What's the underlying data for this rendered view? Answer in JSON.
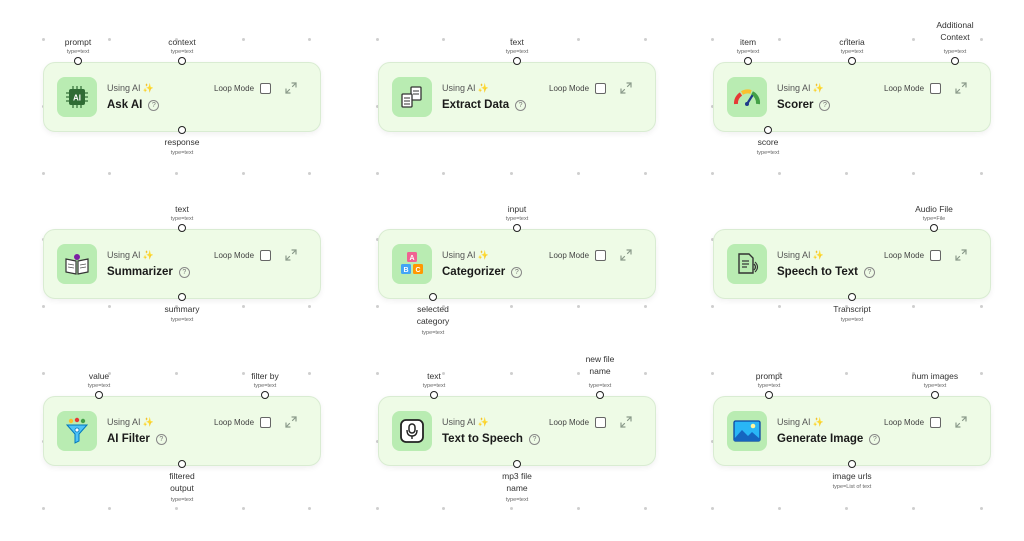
{
  "common": {
    "using_ai": "Using AI",
    "loop_mode": "Loop Mode",
    "help": "?"
  },
  "nodes": [
    {
      "title": "Ask AI",
      "icon": "ai-chip-icon",
      "inputs": [
        {
          "label": "prompt",
          "type": "type=text"
        },
        {
          "label": "context",
          "type": "type=text"
        }
      ],
      "outputs": [
        {
          "label": "response",
          "type": "type=text"
        }
      ]
    },
    {
      "title": "Extract Data",
      "icon": "documents-icon",
      "inputs": [
        {
          "label": "text",
          "type": "type=text"
        }
      ],
      "outputs": []
    },
    {
      "title": "Scorer",
      "icon": "gauge-icon",
      "inputs": [
        {
          "label": "item",
          "type": "type=text"
        },
        {
          "label": "criteria",
          "type": "type=text"
        },
        {
          "label": "Additional Context",
          "type": "type=text"
        }
      ],
      "outputs": [
        {
          "label": "score",
          "type": "type=text"
        }
      ]
    },
    {
      "title": "Summarizer",
      "icon": "book-icon",
      "inputs": [
        {
          "label": "text",
          "type": "type=text"
        }
      ],
      "outputs": [
        {
          "label": "summary",
          "type": "type=text"
        }
      ]
    },
    {
      "title": "Categorizer",
      "icon": "blocks-icon",
      "inputs": [
        {
          "label": "input",
          "type": "type=text"
        }
      ],
      "outputs": [
        {
          "label": "selected category",
          "type": "type=text"
        }
      ]
    },
    {
      "title": "Speech to Text",
      "icon": "speech-doc-icon",
      "inputs": [
        {
          "label": "Audio File",
          "type": "type=File"
        }
      ],
      "outputs": [
        {
          "label": "Transcript",
          "type": "type=text"
        }
      ]
    },
    {
      "title": "AI Filter",
      "icon": "funnel-icon",
      "inputs": [
        {
          "label": "value",
          "type": "type=text"
        },
        {
          "label": "filter by",
          "type": "type=text"
        }
      ],
      "outputs": [
        {
          "label": "filtered output",
          "type": "type=text"
        }
      ]
    },
    {
      "title": "Text to Speech",
      "icon": "microphone-icon",
      "inputs": [
        {
          "label": "text",
          "type": "type=text"
        },
        {
          "label": "new file name",
          "type": "type=text"
        }
      ],
      "outputs": [
        {
          "label": "mp3 file name",
          "type": "type=text"
        }
      ]
    },
    {
      "title": "Generate Image",
      "icon": "image-icon",
      "inputs": [
        {
          "label": "prompt",
          "type": "type=text"
        },
        {
          "label": "num images",
          "type": "type=text"
        }
      ],
      "outputs": [
        {
          "label": "image urls",
          "type": "type=List of text"
        }
      ]
    }
  ]
}
